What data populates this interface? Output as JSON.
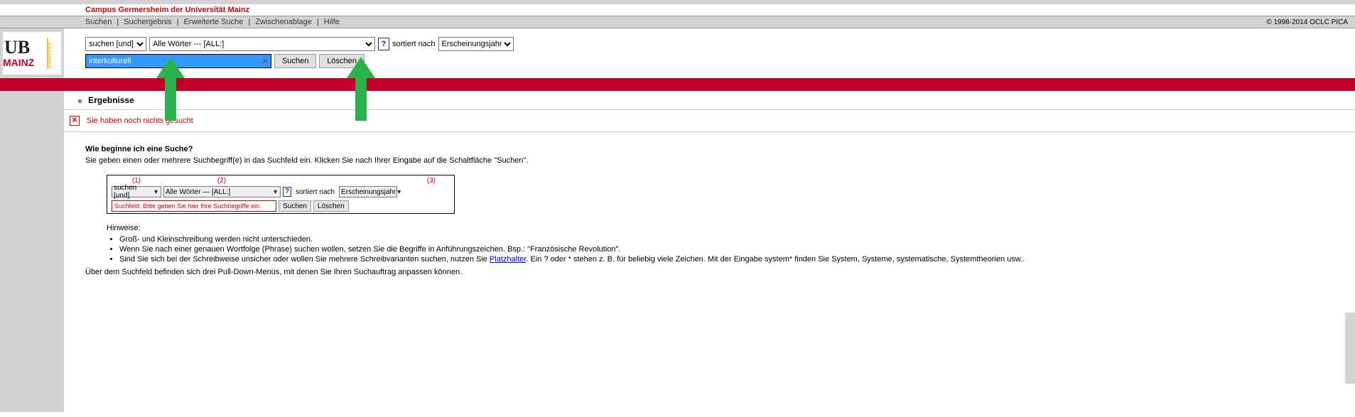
{
  "header": {
    "title": "Campus Germersheim der Universität Mainz",
    "copyright": "© 1998-2014 OCLC PICA"
  },
  "nav": {
    "items": [
      "Suchen",
      "Suchergebnis",
      "Erweiterte Suche",
      "Zwischenablage",
      "Hilfe"
    ]
  },
  "search": {
    "mode_options": [
      "suchen [und]"
    ],
    "mode_selected": "suchen [und]",
    "field_options": [
      "Alle Wörter --- [ALL:]"
    ],
    "field_selected": "Alle Wörter --- [ALL:]",
    "sort_label": "sortiert nach",
    "sort_options": [
      "Erscheinungsjahr"
    ],
    "sort_selected": "Erscheinungsjahr",
    "input_value": "interkulturell",
    "search_btn": "Suchen",
    "clear_btn": "Löschen"
  },
  "results": {
    "heading": "Ergebnisse"
  },
  "notice": {
    "text": "Sie haben noch nichts gesucht"
  },
  "help": {
    "title": "Wie beginne ich eine Suche?",
    "intro": "Sie geben einen oder mehrere Suchbegriff(e) in das Suchfeld ein. Klicken Sie nach Ihrer Eingabe auf die Schaltfläche \"Suchen\".",
    "example": {
      "labels": [
        "(1)",
        "(2)",
        "(3)"
      ],
      "mode": "suchen [und]",
      "field": "Alle Wörter — [ALL:]",
      "sort_label": "sortiert nach",
      "sort": "Erscheinungsjahr",
      "input_placeholder": "Suchfeld: Bitte geben Sie hier Ihre Suchbegriffe ein.",
      "search_btn": "Suchen",
      "clear_btn": "Löschen"
    },
    "hints_title": "Hinweise:",
    "hints": [
      "Groß- und Kleinschreibung werden nicht unterschieden.",
      "Wenn Sie nach einer genauen Wortfolge (Phrase) suchen wollen, setzen Sie die Begriffe in Anführungszeichen. Bsp.: \"Französische Revolution\".",
      {
        "pre": "Sind Sie sich bei der Schreibweise unsicher oder wollen Sie mehrere Schreibvarianten suchen, nutzen Sie ",
        "link": "Platzhalter",
        "post": ". Ein ? oder * stehen z. B. für beliebig viele Zeichen. Mit der Eingabe system* finden Sie System, Systeme, systematische, Systemtheorien usw.."
      }
    ],
    "footer": "Über dem Suchfeld befinden sich drei Pull-Down-Menüs, mit denen Sie Ihren Suchauftrag anpassen können."
  }
}
